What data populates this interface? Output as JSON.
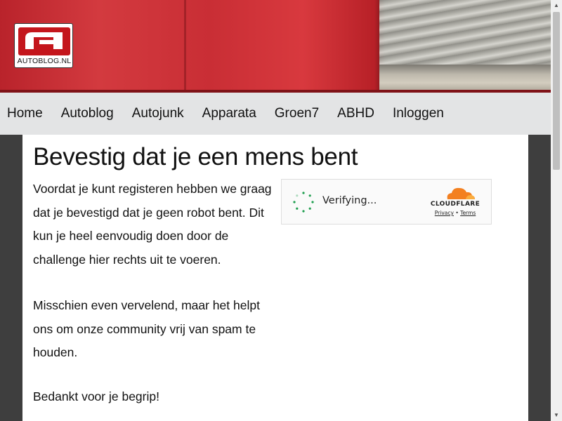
{
  "header": {
    "logo_text": "AUTOBLOG.NL"
  },
  "nav": {
    "items": [
      "Home",
      "Autoblog",
      "Autojunk",
      "Apparata",
      "Groen7",
      "ABHD",
      "Inloggen"
    ]
  },
  "main": {
    "title": "Bevestig dat je een mens bent",
    "paragraph1": "Voordat je kunt registeren hebben we graag dat je bevestigd dat je geen robot bent. Dit kun je heel eenvoudig doen door de challenge hier rechts uit te voeren.",
    "paragraph2": "Misschien even vervelend, maar het helpt ons om onze community vrij van spam te houden.",
    "paragraph3": "Bedankt voor je begrip!"
  },
  "captcha": {
    "status": "Verifying...",
    "brand": "CLOUDFLARE",
    "privacy": "Privacy",
    "separator": "•",
    "terms": "Terms",
    "icons": [
      "spinner-icon",
      "cloudflare-cloud-icon"
    ]
  },
  "colors": {
    "brand_red": "#c4161c",
    "nav_bg": "#e3e4e5",
    "page_bg": "#3e3e3e",
    "cloudflare_orange": "#f38020",
    "spinner_green": "#1f9e4f"
  }
}
